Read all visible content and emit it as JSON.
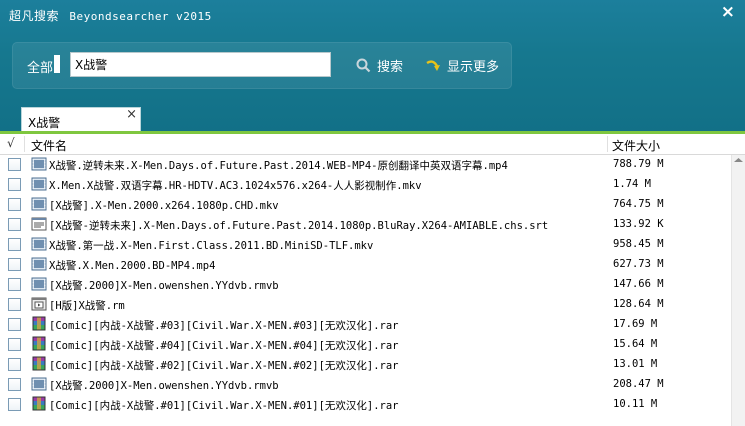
{
  "window": {
    "app_name": "超凡搜索",
    "version": "Beyondsearcher v2015",
    "close_label": "×"
  },
  "search": {
    "scope": "全部",
    "query": "X战警",
    "search_label": "搜索",
    "more_label": "显示更多"
  },
  "tab": {
    "label": "X战警",
    "close_label": "×"
  },
  "columns": {
    "check": "√",
    "name": "文件名",
    "size": "文件大小"
  },
  "files": [
    {
      "icon": "video-file-icon",
      "name": "X战警.逆转未来.X-Men.Days.of.Future.Past.2014.WEB-MP4-原创翻译中英双语字幕.mp4",
      "size": "788.79 M"
    },
    {
      "icon": "video-file-icon",
      "name": "X.Men.X战警.双语字幕.HR-HDTV.AC3.1024x576.x264-人人影视制作.mkv",
      "size": "1.74 M"
    },
    {
      "icon": "video-file-icon",
      "name": "[X战警].X-Men.2000.x264.1080p.CHD.mkv",
      "size": "764.75 M"
    },
    {
      "icon": "text-file-icon",
      "name": "[X战警-逆转未来].X-Men.Days.of.Future.Past.2014.1080p.BluRay.X264-AMIABLE.chs.srt",
      "size": "133.92 K"
    },
    {
      "icon": "video-file-icon",
      "name": "X战警.第一战.X-Men.First.Class.2011.BD.MiniSD-TLF.mkv",
      "size": "958.45 M"
    },
    {
      "icon": "video-file-icon",
      "name": "X战警.X.Men.2000.BD-MP4.mp4",
      "size": "627.73 M"
    },
    {
      "icon": "video-file-icon",
      "name": "[X战警.2000]X-Men.owenshen.YYdvb.rmvb",
      "size": "147.66 M"
    },
    {
      "icon": "media-file-icon",
      "name": "[H版]X战警.rm",
      "size": "128.64 M"
    },
    {
      "icon": "archive-file-icon",
      "name": "[Comic][内战-X战警.#03][Civil.War.X-MEN.#03][无欢汉化].rar",
      "size": "17.69 M"
    },
    {
      "icon": "archive-file-icon",
      "name": "[Comic][内战-X战警.#04][Civil.War.X-MEN.#04][无欢汉化].rar",
      "size": "15.64 M"
    },
    {
      "icon": "archive-file-icon",
      "name": "[Comic][内战-X战警.#02][Civil.War.X-MEN.#02][无欢汉化].rar",
      "size": "13.01 M"
    },
    {
      "icon": "video-file-icon",
      "name": "[X战警.2000]X-Men.owenshen.YYdvb.rmvb",
      "size": "208.47 M"
    },
    {
      "icon": "archive-file-icon",
      "name": "[Comic][内战-X战警.#01][Civil.War.X-MEN.#01][无欢汉化].rar",
      "size": "10.11 M"
    }
  ],
  "colors": {
    "header_bg": "#16788f",
    "tab_accent": "#7fc73f",
    "search_icon": "#c9d6dc",
    "more_icon": "#e7c21a"
  }
}
